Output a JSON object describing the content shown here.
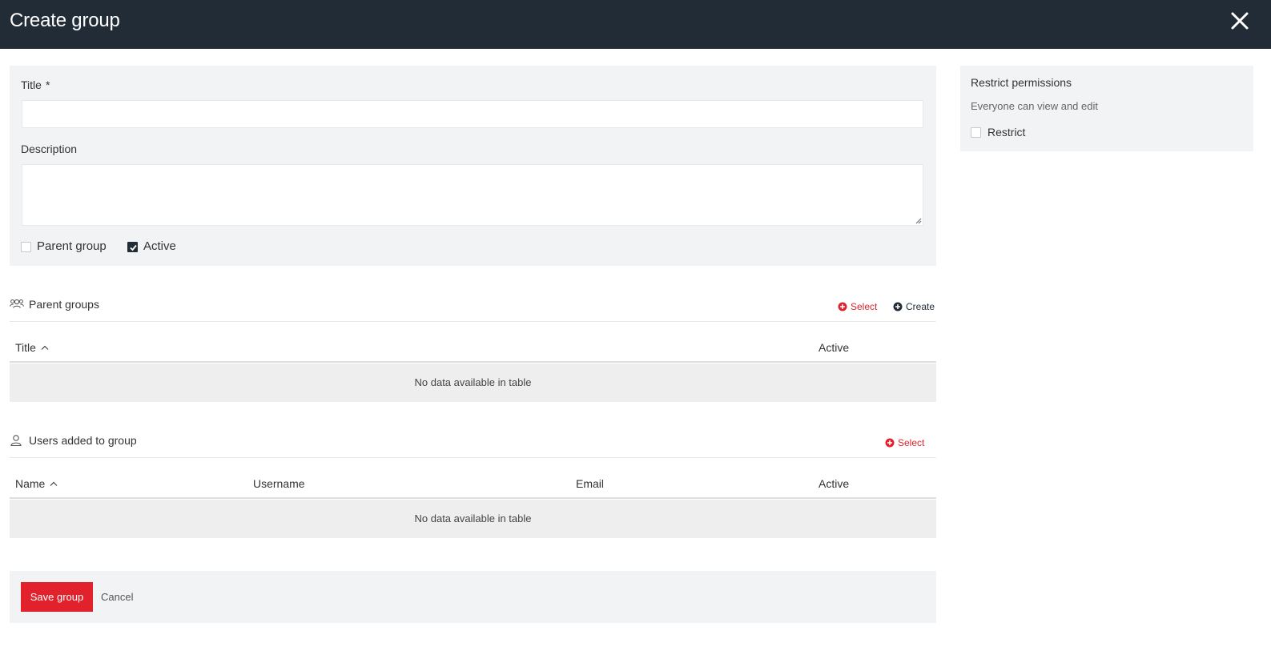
{
  "header": {
    "title": "Create group",
    "close_icon": "close-icon"
  },
  "form": {
    "title_label": "Title",
    "required_mark": "*",
    "title_value": "",
    "description_label": "Description",
    "description_value": "",
    "parent_group_label": "Parent group",
    "parent_group_checked": false,
    "active_label": "Active",
    "active_checked": true
  },
  "permissions": {
    "heading": "Restrict permissions",
    "subtext": "Everyone can view and edit",
    "restrict_label": "Restrict",
    "restrict_checked": false
  },
  "parent_groups": {
    "heading": "Parent groups",
    "icon": "users-group-icon",
    "select_label": "Select",
    "create_label": "Create",
    "columns": [
      "Title",
      "Active"
    ],
    "sort_column": "Title",
    "empty_text": "No data available in table"
  },
  "users": {
    "heading": "Users added to group",
    "icon": "user-icon",
    "select_label": "Select",
    "columns": [
      "Name",
      "Username",
      "Email",
      "Active"
    ],
    "sort_column": "Name",
    "empty_text": "No data available in table"
  },
  "footer": {
    "save_label": "Save group",
    "cancel_label": "Cancel"
  },
  "colors": {
    "header_bg": "#222c37",
    "accent": "#e1222d",
    "panel_bg": "#f2f3f5"
  }
}
